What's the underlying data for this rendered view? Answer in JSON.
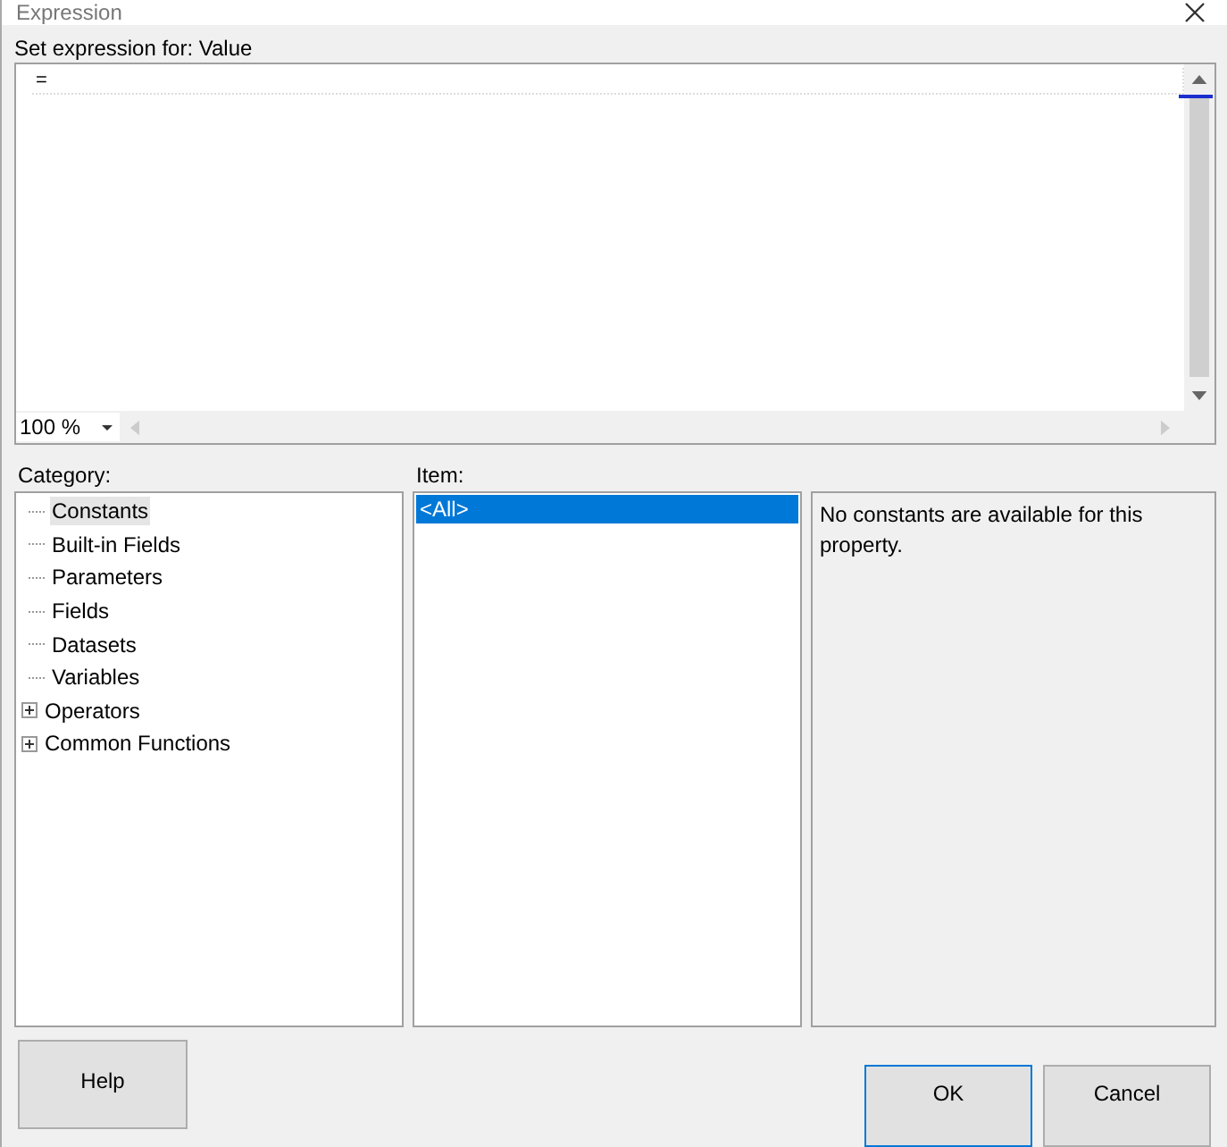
{
  "window": {
    "title": "Expression"
  },
  "expression": {
    "label": "Set expression for: Value",
    "value": "=",
    "zoom": "100 %"
  },
  "category": {
    "label": "Category:",
    "items": [
      {
        "label": "Constants",
        "selected": true,
        "kind": "leaf"
      },
      {
        "label": "Built-in Fields",
        "selected": false,
        "kind": "leaf"
      },
      {
        "label": "Parameters",
        "selected": false,
        "kind": "leaf"
      },
      {
        "label": "Fields",
        "selected": false,
        "kind": "leaf"
      },
      {
        "label": "Datasets",
        "selected": false,
        "kind": "leaf"
      },
      {
        "label": "Variables",
        "selected": false,
        "kind": "leaf"
      },
      {
        "label": "Operators",
        "selected": false,
        "kind": "group",
        "expanded": false
      },
      {
        "label": "Common Functions",
        "selected": false,
        "kind": "group",
        "expanded": false
      }
    ]
  },
  "item": {
    "label": "Item:",
    "items": [
      {
        "label": "<All>",
        "selected": true
      }
    ]
  },
  "description": "No constants are available for this property.",
  "buttons": {
    "help": "Help",
    "ok": "OK",
    "cancel": "Cancel"
  }
}
